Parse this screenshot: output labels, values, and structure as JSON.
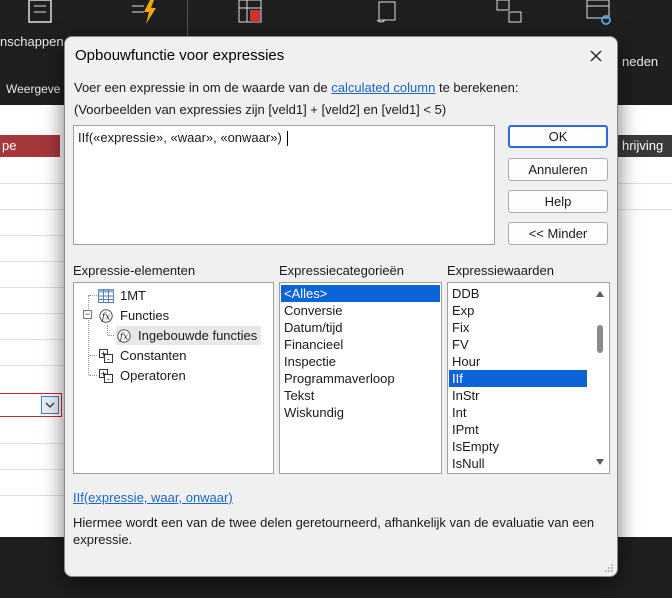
{
  "background_app": {
    "ribbon_labels": [
      "nschappen",
      "Weergeve",
      "neden"
    ],
    "header_left": "pe",
    "header_right": "hrijving"
  },
  "dialog": {
    "title": "Opbouwfunctie voor expressies",
    "intro_prefix": "Voer een expressie in om de waarde van de ",
    "intro_link": "calculated column",
    "intro_suffix": " te berekenen:",
    "intro_example": "(Voorbeelden van expressies zijn [veld1] + [veld2] en [veld1] < 5)",
    "expression_value": "IIf(«expressie», «waar», «onwaar») ",
    "buttons": {
      "ok": "OK",
      "cancel": "Annuleren",
      "help": "Help",
      "less": "<< Minder"
    },
    "elements_label": "Expressie-elementen",
    "categories_label": "Expressiecategorieën",
    "values_label": "Expressiewaarden",
    "tree": {
      "table": "1MT",
      "functions": "Functies",
      "builtin": "Ingebouwde functies",
      "constants": "Constanten",
      "operators": "Operatoren"
    },
    "categories": [
      "<Alles>",
      "Conversie",
      "Datum/tijd",
      "Financieel",
      "Inspectie",
      "Programmaverloop",
      "Tekst",
      "Wiskundig"
    ],
    "selected_category": 0,
    "values": [
      "DDB",
      "Exp",
      "Fix",
      "FV",
      "Hour",
      "IIf",
      "InStr",
      "Int",
      "IPmt",
      "IsEmpty",
      "IsNull"
    ],
    "selected_value": 5,
    "function_signature": "IIf(expressie, waar, onwaar)",
    "description": "Hiermee wordt een van de twee delen geretourneerd, afhankelijk van de evaluatie van een expressie."
  },
  "colors": {
    "accent": "#0a64d6",
    "link": "#1a66c2",
    "header_red": "#a4373a"
  }
}
